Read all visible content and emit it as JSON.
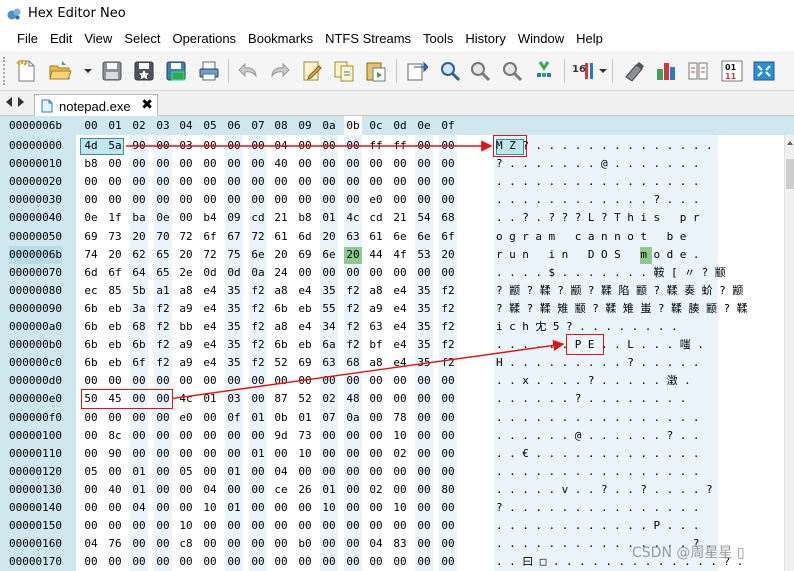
{
  "window": {
    "title": "Hex Editor Neo"
  },
  "menu": [
    "File",
    "Edit",
    "View",
    "Select",
    "Operations",
    "Bookmarks",
    "NTFS Streams",
    "Tools",
    "History",
    "Window",
    "Help"
  ],
  "toolbar": {
    "icons": [
      "new-file-icon",
      "open-file-icon",
      "save-icon",
      "save-all-icon",
      "save-as-icon",
      "print-icon",
      "undo-icon",
      "redo-icon",
      "edit-icon",
      "find-icon",
      "find-next-icon",
      "zoom-in-icon",
      "zoom-out-icon",
      "zoom-fit-icon",
      "bookmark-icon",
      "columns-icon",
      "pattern-icon",
      "encoding-icon",
      "compare-icon",
      "checksum-icon",
      "binary-icon",
      "screen-icon"
    ],
    "columns_label": "16",
    "binary_label": "01 11"
  },
  "tabs": [
    {
      "label": "notepad.exe",
      "close": "✖"
    }
  ],
  "editor": {
    "corner_label": "0000006b",
    "column_headers": [
      "00",
      "01",
      "02",
      "03",
      "04",
      "05",
      "06",
      "07",
      "08",
      "09",
      "0a",
      "0b",
      "0c",
      "0d",
      "0e",
      "0f"
    ],
    "current_column_header": "0b",
    "current_row_address": "0000006b",
    "rows": [
      {
        "addr": "00000000",
        "bytes": [
          "4d",
          "5a",
          "90",
          "00",
          "03",
          "00",
          "00",
          "00",
          "04",
          "00",
          "00",
          "00",
          "ff",
          "ff",
          "00",
          "00"
        ],
        "ascii": "MZ?.............."
      },
      {
        "addr": "00000010",
        "bytes": [
          "b8",
          "00",
          "00",
          "00",
          "00",
          "00",
          "00",
          "00",
          "40",
          "00",
          "00",
          "00",
          "00",
          "00",
          "00",
          "00"
        ],
        "ascii": "?.......@......."
      },
      {
        "addr": "00000020",
        "bytes": [
          "00",
          "00",
          "00",
          "00",
          "00",
          "00",
          "00",
          "00",
          "00",
          "00",
          "00",
          "00",
          "00",
          "00",
          "00",
          "00"
        ],
        "ascii": "................"
      },
      {
        "addr": "00000030",
        "bytes": [
          "00",
          "00",
          "00",
          "00",
          "00",
          "00",
          "00",
          "00",
          "00",
          "00",
          "00",
          "00",
          "e0",
          "00",
          "00",
          "00"
        ],
        "ascii": "............?..."
      },
      {
        "addr": "00000040",
        "bytes": [
          "0e",
          "1f",
          "ba",
          "0e",
          "00",
          "b4",
          "09",
          "cd",
          "21",
          "b8",
          "01",
          "4c",
          "cd",
          "21",
          "54",
          "68"
        ],
        "ascii": "..?.???L?This pr"
      },
      {
        "addr": "00000050",
        "bytes": [
          "69",
          "73",
          "20",
          "70",
          "72",
          "6f",
          "67",
          "72",
          "61",
          "6d",
          "20",
          "63",
          "61",
          "6e",
          "6e",
          "6f"
        ],
        "ascii": "ogram cannot be"
      },
      {
        "addr": "0000006b",
        "bytes": [
          "74",
          "20",
          "62",
          "65",
          "20",
          "72",
          "75",
          "6e",
          "20",
          "69",
          "6e",
          "20",
          "44",
          "4f",
          "53",
          "20"
        ],
        "ascii": "run in DOS mode."
      },
      {
        "addr": "00000070",
        "bytes": [
          "6d",
          "6f",
          "64",
          "65",
          "2e",
          "0d",
          "0d",
          "0a",
          "24",
          "00",
          "00",
          "00",
          "00",
          "00",
          "00",
          "00"
        ],
        "ascii": "....$.......鞍[〃?颛"
      },
      {
        "addr": "00000080",
        "bytes": [
          "ec",
          "85",
          "5b",
          "a1",
          "a8",
          "e4",
          "35",
          "f2",
          "a8",
          "e4",
          "35",
          "f2",
          "a8",
          "e4",
          "35",
          "f2"
        ],
        "ascii": "?颛?鞣?颛?鞣陷颛?鞣奏蚧?颛"
      },
      {
        "addr": "00000090",
        "bytes": [
          "6b",
          "eb",
          "3a",
          "f2",
          "a9",
          "e4",
          "35",
          "f2",
          "6b",
          "eb",
          "55",
          "f2",
          "a9",
          "e4",
          "35",
          "f2"
        ],
        "ascii": "?鞣?鞣雉颛?鞣雉蚩?鞣腠颛?鞣"
      },
      {
        "addr": "000000a0",
        "bytes": [
          "6b",
          "eb",
          "68",
          "f2",
          "bb",
          "e4",
          "35",
          "f2",
          "a8",
          "e4",
          "34",
          "f2",
          "63",
          "e4",
          "35",
          "f2"
        ],
        "ascii": "ich冘5?........"
      },
      {
        "addr": "000000b0",
        "bytes": [
          "6b",
          "eb",
          "6b",
          "f2",
          "a9",
          "e4",
          "35",
          "f2",
          "6b",
          "eb",
          "6a",
          "f2",
          "bf",
          "e4",
          "35",
          "f2"
        ],
        "ascii": "......PE..L...嗤."
      },
      {
        "addr": "000000c0",
        "bytes": [
          "6b",
          "eb",
          "6f",
          "f2",
          "a9",
          "e4",
          "35",
          "f2",
          "52",
          "69",
          "63",
          "68",
          "a8",
          "e4",
          "35",
          "f2"
        ],
        "ascii": "H.........?....."
      },
      {
        "addr": "000000d0",
        "bytes": [
          "00",
          "00",
          "00",
          "00",
          "00",
          "00",
          "00",
          "00",
          "00",
          "00",
          "00",
          "00",
          "00",
          "00",
          "00",
          "00"
        ],
        "ascii": "..x....?.....澂."
      },
      {
        "addr": "000000e0",
        "bytes": [
          "50",
          "45",
          "00",
          "00",
          "4c",
          "01",
          "03",
          "00",
          "87",
          "52",
          "02",
          "48",
          "00",
          "00",
          "00",
          "00"
        ],
        "ascii": "......?........"
      },
      {
        "addr": "000000f0",
        "bytes": [
          "00",
          "00",
          "00",
          "00",
          "e0",
          "00",
          "0f",
          "01",
          "0b",
          "01",
          "07",
          "0a",
          "00",
          "78",
          "00",
          "00"
        ],
        "ascii": "................"
      },
      {
        "addr": "00000100",
        "bytes": [
          "00",
          "8c",
          "00",
          "00",
          "00",
          "00",
          "00",
          "00",
          "9d",
          "73",
          "00",
          "00",
          "00",
          "10",
          "00",
          "00"
        ],
        "ascii": "......@......?.."
      },
      {
        "addr": "00000110",
        "bytes": [
          "00",
          "90",
          "00",
          "00",
          "00",
          "00",
          "00",
          "01",
          "00",
          "10",
          "00",
          "00",
          "00",
          "02",
          "00",
          "00"
        ],
        "ascii": "..€............."
      },
      {
        "addr": "00000120",
        "bytes": [
          "05",
          "00",
          "01",
          "00",
          "05",
          "00",
          "01",
          "00",
          "04",
          "00",
          "00",
          "00",
          "00",
          "00",
          "00",
          "00"
        ],
        "ascii": "................"
      },
      {
        "addr": "00000130",
        "bytes": [
          "00",
          "40",
          "01",
          "00",
          "00",
          "04",
          "00",
          "00",
          "ce",
          "26",
          "01",
          "00",
          "02",
          "00",
          "00",
          "80"
        ],
        "ascii": ".....v..?..?....?"
      },
      {
        "addr": "00000140",
        "bytes": [
          "00",
          "00",
          "04",
          "00",
          "00",
          "10",
          "01",
          "00",
          "00",
          "00",
          "10",
          "00",
          "00",
          "10",
          "00",
          "00"
        ],
        "ascii": "?..............."
      },
      {
        "addr": "00000150",
        "bytes": [
          "00",
          "00",
          "00",
          "00",
          "10",
          "00",
          "00",
          "00",
          "00",
          "00",
          "00",
          "00",
          "00",
          "00",
          "00",
          "00"
        ],
        "ascii": "............P..."
      },
      {
        "addr": "00000160",
        "bytes": [
          "04",
          "76",
          "00",
          "00",
          "c8",
          "00",
          "00",
          "00",
          "00",
          "b0",
          "00",
          "00",
          "04",
          "83",
          "00",
          "00"
        ],
        "ascii": "...............?."
      },
      {
        "addr": "00000170",
        "bytes": [
          "00",
          "00",
          "00",
          "00",
          "00",
          "00",
          "00",
          "00",
          "00",
          "00",
          "00",
          "00",
          "00",
          "00",
          "00",
          "00"
        ],
        "ascii": "..曰□.............?."
      }
    ]
  },
  "watermark": "CSDN @周星星 ▯"
}
